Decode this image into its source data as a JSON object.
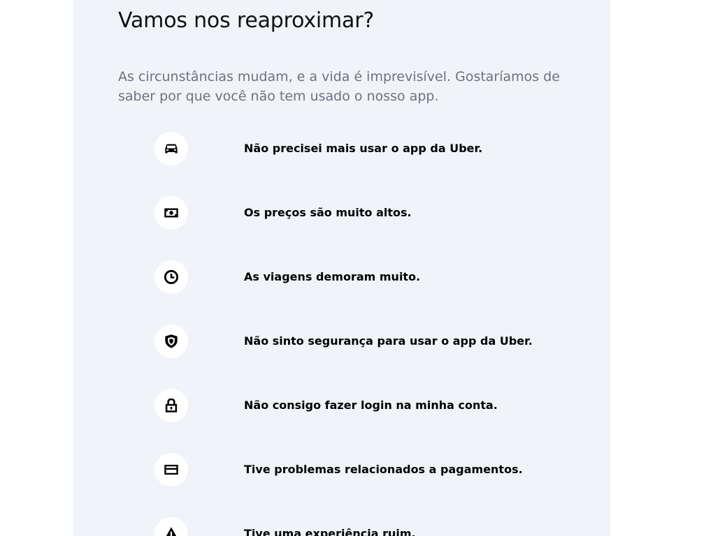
{
  "page": {
    "title": "Vamos nos reaproximar?",
    "subtitle": "As circunstâncias mudam, e a vida é imprevisível. Gostaríamos de saber por que você não tem usado o nosso app."
  },
  "options": [
    {
      "icon": "car-icon",
      "label": "Não precisei mais usar o app da Uber."
    },
    {
      "icon": "money-icon",
      "label": "Os preços são muito altos."
    },
    {
      "icon": "clock-icon",
      "label": "As viagens demoram muito."
    },
    {
      "icon": "shield-icon",
      "label": "Não sinto segurança para usar o app da Uber."
    },
    {
      "icon": "lock-icon",
      "label": "Não consigo fazer login na minha conta."
    },
    {
      "icon": "credit-card-icon",
      "label": "Tive problemas relacionados a pagamentos."
    },
    {
      "icon": "warning-icon",
      "label": "Tive uma experiência ruim."
    }
  ]
}
